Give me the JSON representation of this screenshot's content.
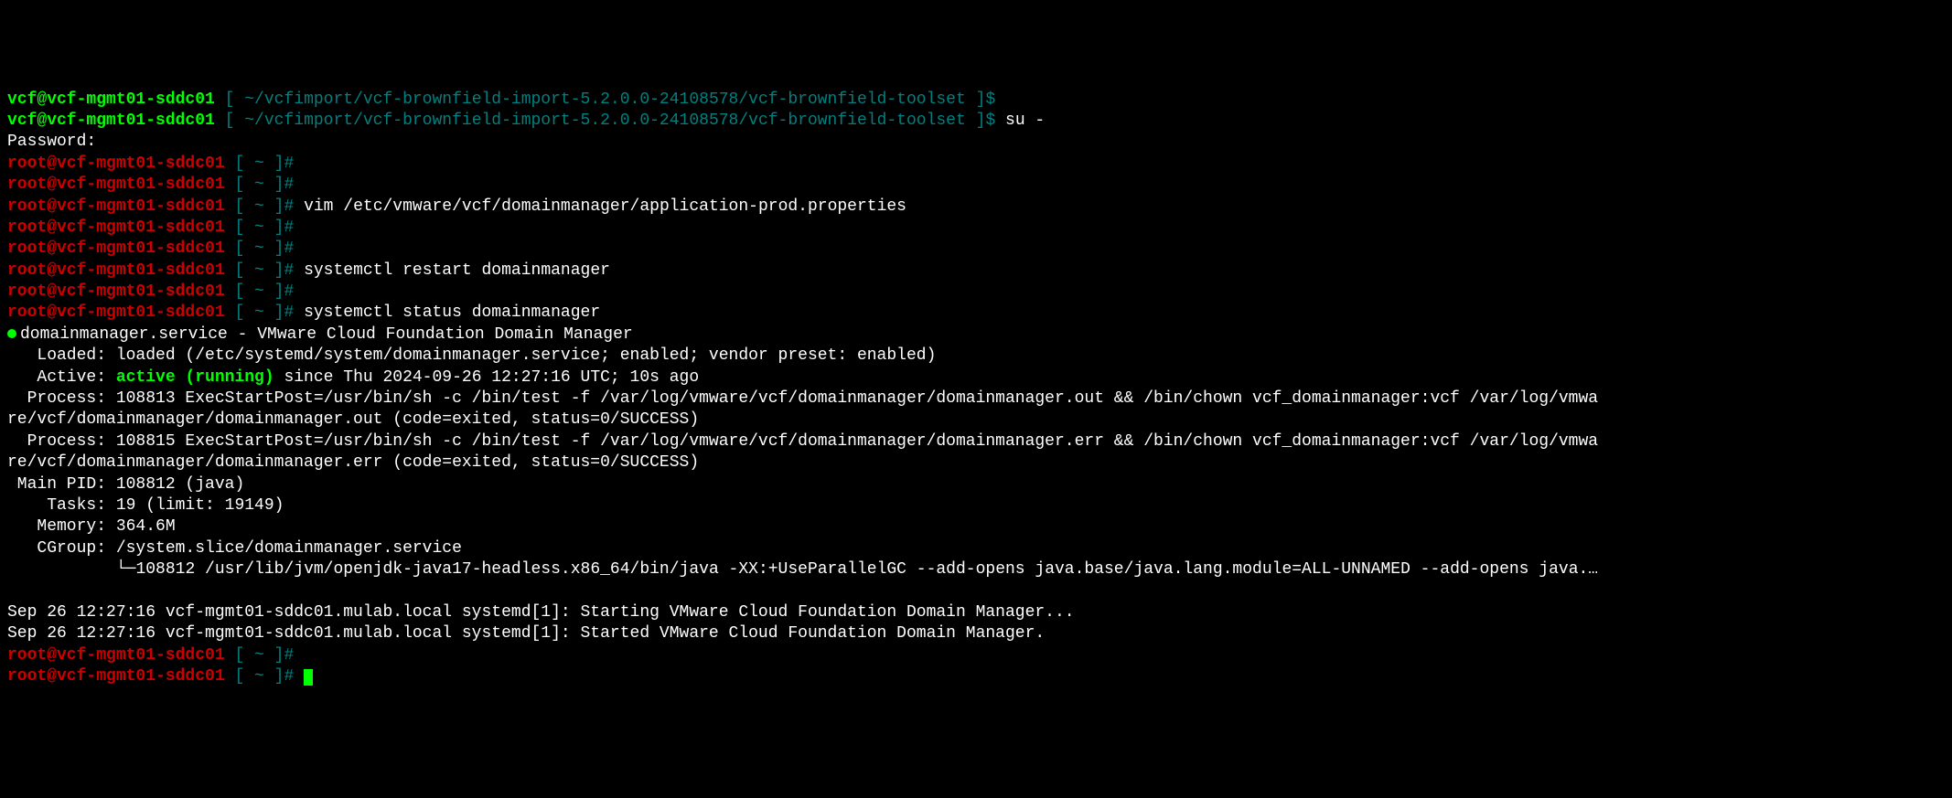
{
  "prompt": {
    "user_host": "vcf@vcf-mgmt01-sddc01",
    "root_host": "root@vcf-mgmt01-sddc01",
    "user_path": " ~/vcfimport/vcf-brownfield-import-5.2.0.0-24108578/vcf-brownfield-toolset ",
    "root_path": " ~ ",
    "lbr": " [",
    "rbr_user": "]$",
    "rbr_root": "]#",
    "space": " "
  },
  "cmd": {
    "su": "su -",
    "password": "Password:",
    "vim": "vim /etc/vmware/vcf/domainmanager/application-prod.properties",
    "restart": "systemctl restart domainmanager",
    "status": "systemctl status domainmanager"
  },
  "svc": {
    "name": "domainmanager.service - VMware Cloud Foundation Domain Manager",
    "loaded": "   Loaded: loaded (/etc/systemd/system/domainmanager.service; enabled; vendor preset: enabled)",
    "active_label": "   Active: ",
    "active_state": "active (running)",
    "active_since": " since Thu 2024-09-26 12:27:16 UTC; 10s ago",
    "proc1a": "  Process: 108813 ExecStartPost=/usr/bin/sh -c /bin/test -f /var/log/vmware/vcf/domainmanager/domainmanager.out && /bin/chown vcf_domainmanager:vcf /var/log/vmwa",
    "proc1b": "re/vcf/domainmanager/domainmanager.out (code=exited, status=0/SUCCESS)",
    "proc2a": "  Process: 108815 ExecStartPost=/usr/bin/sh -c /bin/test -f /var/log/vmware/vcf/domainmanager/domainmanager.err && /bin/chown vcf_domainmanager:vcf /var/log/vmwa",
    "proc2b": "re/vcf/domainmanager/domainmanager.err (code=exited, status=0/SUCCESS)",
    "mainpid": " Main PID: 108812 (java)",
    "tasks": "    Tasks: 19 (limit: 19149)",
    "memory": "   Memory: 364.6M",
    "cgroup": "   CGroup: /system.slice/domainmanager.service",
    "tree": "           └─",
    "java": "108812 /usr/lib/jvm/openjdk-java17-headless.x86_64/bin/java -XX:+UseParallelGC --add-opens java.base/java.lang.module=ALL-UNNAMED --add-opens java.…"
  },
  "log": {
    "l1": "Sep 26 12:27:16 vcf-mgmt01-sddc01.mulab.local systemd[1]: Starting VMware Cloud Foundation Domain Manager...",
    "l2": "Sep 26 12:27:16 vcf-mgmt01-sddc01.mulab.local systemd[1]: Started VMware Cloud Foundation Domain Manager."
  }
}
